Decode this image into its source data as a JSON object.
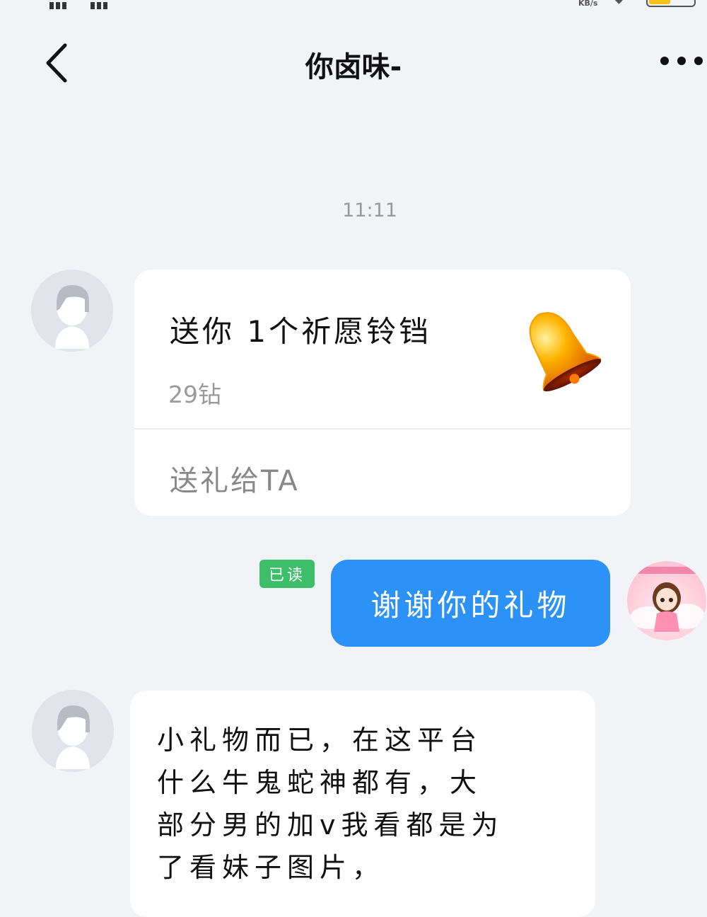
{
  "header": {
    "title": "你卤味-"
  },
  "status_bar": {
    "speed_unit": "KB/s"
  },
  "chat": {
    "timestamp": "11:11",
    "gift_message": {
      "title": "送你 1个祈愿铃铛",
      "price": "29钻",
      "action": "送礼给TA",
      "icon": "bell-icon"
    },
    "outgoing_message": {
      "read_status": "已读",
      "text": "谢谢你的礼物"
    },
    "incoming_message": {
      "text": "小礼物而已，在这平台\n什么牛鬼蛇神都有，大\n部分男的加v我看都是为\n了看妹子图片，"
    }
  },
  "colors": {
    "background": "#f2f3f7",
    "outgoing_bubble": "#2c92f7",
    "read_badge": "#3dbf6a"
  }
}
